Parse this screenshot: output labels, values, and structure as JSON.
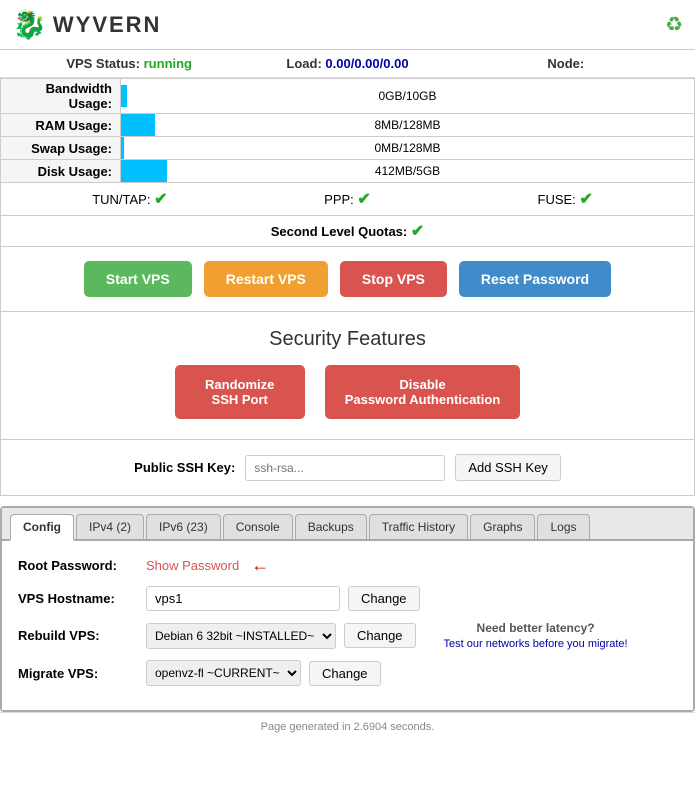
{
  "header": {
    "logo_text": "WYVERN",
    "logo_icon": "🐉",
    "refresh_icon": "♻"
  },
  "status_bar": {
    "vps_status_label": "VPS Status:",
    "vps_status_value": "running",
    "load_label": "Load:",
    "load_value": "0.00/0.00/0.00",
    "node_label": "Node:"
  },
  "stats": [
    {
      "label": "Bandwidth Usage:",
      "bar_pct": 1,
      "bar_text": "0GB/10GB"
    },
    {
      "label": "RAM Usage:",
      "bar_pct": 6,
      "bar_text": "8MB/128MB"
    },
    {
      "label": "Swap Usage:",
      "bar_pct": 0.5,
      "bar_text": "0MB/128MB"
    },
    {
      "label": "Disk Usage:",
      "bar_pct": 8,
      "bar_text": "412MB/5GB"
    }
  ],
  "features": {
    "tun_tap_label": "TUN/TAP:",
    "tun_tap_value": "✔",
    "ppp_label": "PPP:",
    "ppp_value": "✔",
    "fuse_label": "FUSE:",
    "fuse_value": "✔"
  },
  "quotas": {
    "label": "Second Level Quotas:",
    "value": "✔"
  },
  "buttons": {
    "start": "Start VPS",
    "restart": "Restart VPS",
    "stop": "Stop VPS",
    "reset_password": "Reset Password"
  },
  "security": {
    "title": "Security Features",
    "randomize_ssh": "Randomize\nSSH Port",
    "disable_password": "Disable\nPassword Authentication"
  },
  "ssh_key": {
    "label": "Public SSH Key:",
    "placeholder": "ssh-rsa...",
    "button": "Add SSH Key"
  },
  "tabs": {
    "items": [
      {
        "id": "config",
        "label": "Config",
        "active": true
      },
      {
        "id": "ipv4",
        "label": "IPv4 (2)",
        "active": false
      },
      {
        "id": "ipv6",
        "label": "IPv6 (23)",
        "active": false
      },
      {
        "id": "console",
        "label": "Console",
        "active": false
      },
      {
        "id": "backups",
        "label": "Backups",
        "active": false
      },
      {
        "id": "traffic_history",
        "label": "Traffic History",
        "active": false
      },
      {
        "id": "graphs",
        "label": "Graphs",
        "active": false
      },
      {
        "id": "logs",
        "label": "Logs",
        "active": false
      }
    ]
  },
  "config_tab": {
    "root_password_label": "Root Password:",
    "show_password_text": "Show Password",
    "vps_hostname_label": "VPS Hostname:",
    "vps_hostname_value": "vps1",
    "hostname_change_btn": "Change",
    "rebuild_vps_label": "Rebuild VPS:",
    "rebuild_vps_option": "Debian 6 32bit ~INSTALLED~",
    "rebuild_change_btn": "Change",
    "migrate_vps_label": "Migrate VPS:",
    "migrate_vps_option": "openvz-fl ~CURRENT~",
    "migrate_change_btn": "Change",
    "latency_title": "Need better latency?",
    "latency_link_text": "Test our networks before you migrate!"
  },
  "footer": {
    "text": "Page generated in 2.6904 seconds."
  }
}
